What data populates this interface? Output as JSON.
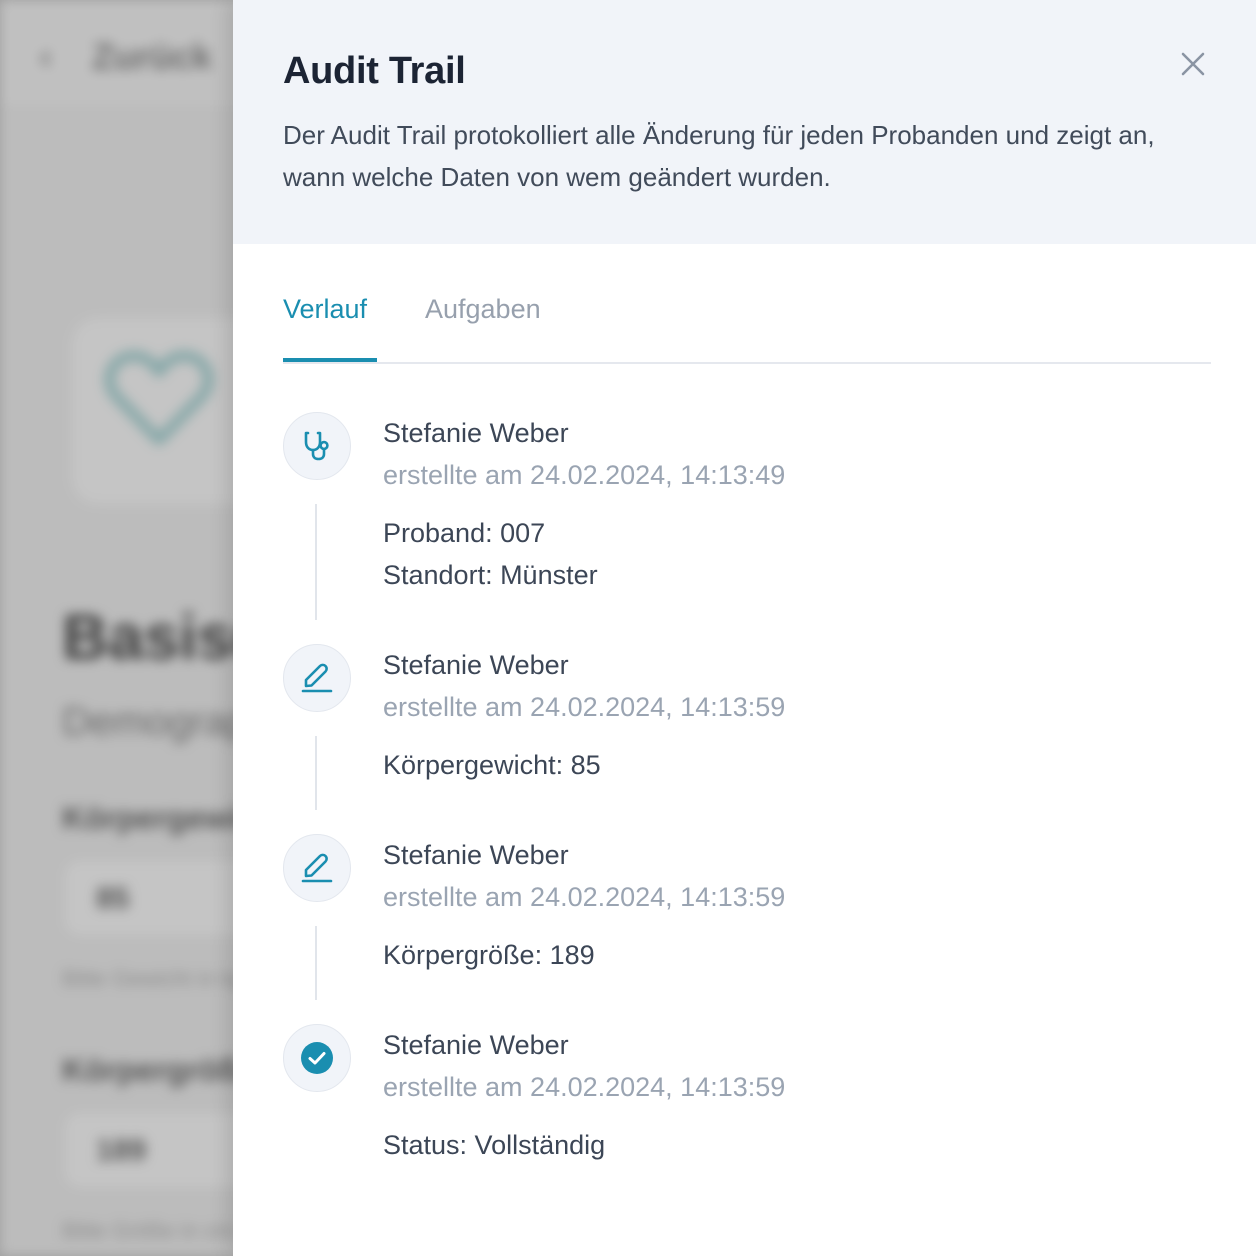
{
  "background": {
    "back_label": "Zurück",
    "page_title": "Basisdaten",
    "page_subtitle": "Demographie",
    "field_1_label": "Körpergewicht",
    "field_1_value": "85",
    "field_1_hint": "Bitte Gewicht in kg angeben",
    "field_2_label": "Körpergröße",
    "field_2_value": "189",
    "field_2_hint": "Bitte Größe in cm angeben"
  },
  "drawer": {
    "title": "Audit Trail",
    "description": "Der Audit Trail protokolliert alle Änderung für jeden Probanden und zeigt an, wann welche Daten von wem geändert wurden.",
    "close_icon": "close-icon",
    "tabs": [
      {
        "label": "Verlauf",
        "active": true
      },
      {
        "label": "Aufgaben",
        "active": false
      }
    ],
    "entries": [
      {
        "icon": "stethoscope-icon",
        "author": "Stefanie Weber",
        "meta": "erstellte am 24.02.2024, 14:13:49",
        "changes": [
          "Proband: 007",
          "Standort: Münster"
        ]
      },
      {
        "icon": "pencil-icon",
        "author": "Stefanie Weber",
        "meta": "erstellte am 24.02.2024, 14:13:59",
        "changes": [
          "Körpergewicht: 85"
        ]
      },
      {
        "icon": "pencil-icon",
        "author": "Stefanie Weber",
        "meta": "erstellte am 24.02.2024, 14:13:59",
        "changes": [
          "Körpergröße: 189"
        ]
      },
      {
        "icon": "check-circle-icon",
        "author": "Stefanie Weber",
        "meta": "erstellte am 24.02.2024, 14:13:59",
        "changes": [
          "Status: Vollständig"
        ]
      }
    ]
  },
  "colors": {
    "accent": "#1a8eb0",
    "header_bg": "#f1f4f9",
    "text_primary": "#3c4656",
    "text_muted": "#9aa4b2"
  }
}
